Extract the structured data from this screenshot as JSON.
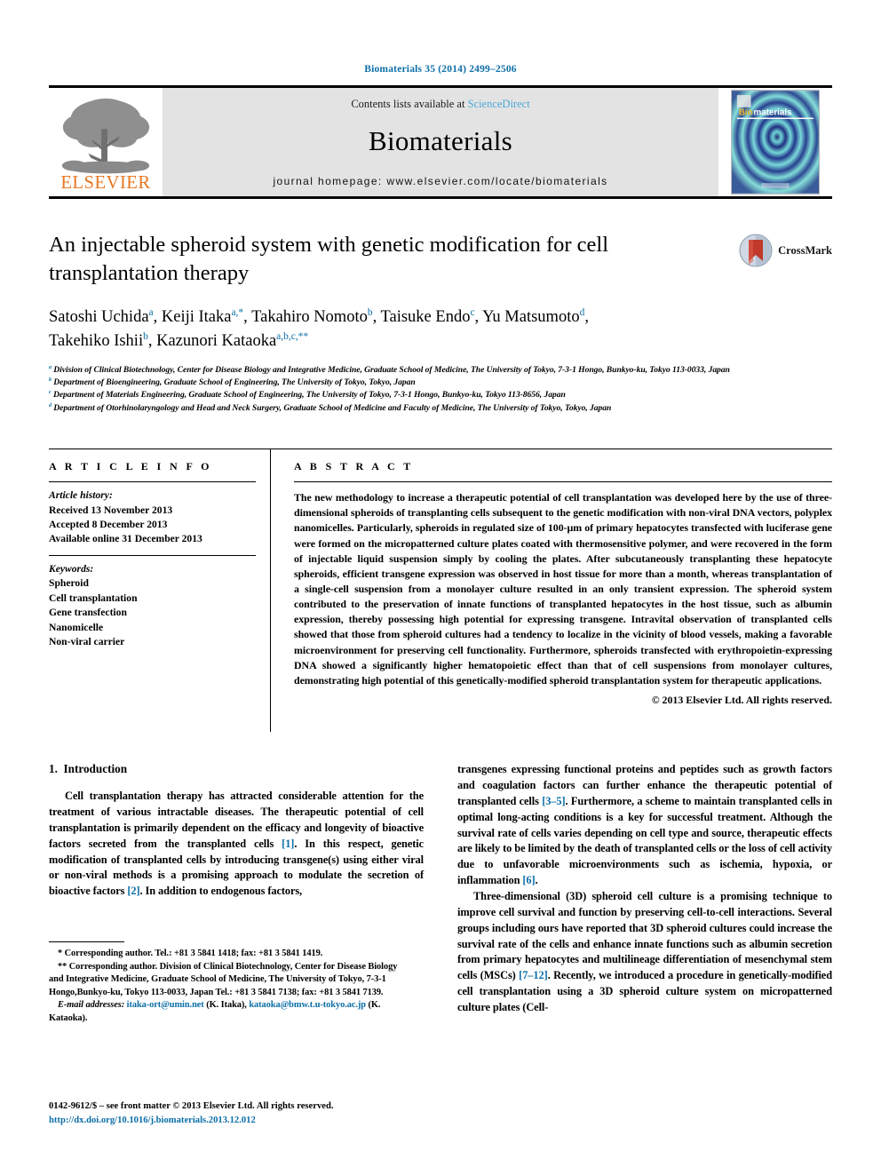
{
  "citation": {
    "journal": "Biomaterials",
    "detail": "35 (2014) 2499–2506",
    "full": "Biomaterials 35 (2014) 2499–2506"
  },
  "masthead": {
    "contents_prefix": "Contents lists available at ",
    "contents_link": "ScienceDirect",
    "journal_name": "Biomaterials",
    "homepage": "journal homepage: www.elsevier.com/locate/biomaterials",
    "publisher_logo_text": "ELSEVIER",
    "cover_title_a": "Bio",
    "cover_title_b": "materials"
  },
  "article": {
    "title": "An injectable spheroid system with genetic modification for cell transplantation therapy",
    "crossmark_label": "CrossMark",
    "authors_line_1": "Satoshi Uchida a, Keiji Itaka a,*, Takahiro Nomoto b, Taisuke Endo c, Yu Matsumoto d,",
    "authors_line_2": "Takehiko Ishii b, Kazunori Kataoka a,b,c,**",
    "authors": [
      {
        "name": "Satoshi Uchida",
        "sup": "a"
      },
      {
        "name": "Keiji Itaka",
        "sup": "a,*"
      },
      {
        "name": "Takahiro Nomoto",
        "sup": "b"
      },
      {
        "name": "Taisuke Endo",
        "sup": "c"
      },
      {
        "name": "Yu Matsumoto",
        "sup": "d"
      },
      {
        "name": "Takehiko Ishii",
        "sup": "b"
      },
      {
        "name": "Kazunori Kataoka",
        "sup": "a,b,c,**"
      }
    ],
    "affiliations": [
      {
        "mark": "a",
        "text": "Division of Clinical Biotechnology, Center for Disease Biology and Integrative Medicine, Graduate School of Medicine, The University of Tokyo, 7-3-1 Hongo, Bunkyo-ku, Tokyo 113-0033, Japan"
      },
      {
        "mark": "b",
        "text": "Department of Bioengineering, Graduate School of Engineering, The University of Tokyo, Tokyo, Japan"
      },
      {
        "mark": "c",
        "text": "Department of Materials Engineering, Graduate School of Engineering, The University of Tokyo, 7-3-1 Hongo, Bunkyo-ku, Tokyo 113-8656, Japan"
      },
      {
        "mark": "d",
        "text": "Department of Otorhinolaryngology and Head and Neck Surgery, Graduate School of Medicine and Faculty of Medicine, The University of Tokyo, Tokyo, Japan"
      }
    ]
  },
  "article_info": {
    "heading": "A R T I C L E   I N F O",
    "history_label": "Article history:",
    "history": [
      "Received 13 November 2013",
      "Accepted 8 December 2013",
      "Available online 31 December 2013"
    ],
    "keywords_label": "Keywords:",
    "keywords": [
      "Spheroid",
      "Cell transplantation",
      "Gene transfection",
      "Nanomicelle",
      "Non-viral carrier"
    ]
  },
  "abstract": {
    "heading": "A B S T R A C T",
    "text": "The new methodology to increase a therapeutic potential of cell transplantation was developed here by the use of three-dimensional spheroids of transplanting cells subsequent to the genetic modification with non-viral DNA vectors, polyplex nanomicelles. Particularly, spheroids in regulated size of 100-µm of primary hepatocytes transfected with luciferase gene were formed on the micropatterned culture plates coated with thermosensitive polymer, and were recovered in the form of injectable liquid suspension simply by cooling the plates. After subcutaneously transplanting these hepatocyte spheroids, efficient transgene expression was observed in host tissue for more than a month, whereas transplantation of a single-cell suspension from a monolayer culture resulted in an only transient expression. The spheroid system contributed to the preservation of innate functions of transplanted hepatocytes in the host tissue, such as albumin expression, thereby possessing high potential for expressing transgene. Intravital observation of transplanted cells showed that those from spheroid cultures had a tendency to localize in the vicinity of blood vessels, making a favorable microenvironment for preserving cell functionality. Furthermore, spheroids transfected with erythropoietin-expressing DNA showed a significantly higher hematopoietic effect than that of cell suspensions from monolayer cultures, demonstrating high potential of this genetically-modified spheroid transplantation system for therapeutic applications.",
    "copyright": "© 2013 Elsevier Ltd. All rights reserved."
  },
  "introduction": {
    "section_number": "1.",
    "section_title": "Introduction",
    "left_paragraph_1_a": "Cell transplantation therapy has attracted considerable attention for the treatment of various intractable diseases. The therapeutic potential of cell transplantation is primarily dependent on the efficacy and longevity of bioactive factors secreted from the transplanted cells ",
    "left_ref_1": "[1]",
    "left_paragraph_1_b": ". In this respect, genetic modification of transplanted cells by introducing transgene(s) using either viral or non-viral methods is a promising approach to modulate the secretion of bioactive factors ",
    "left_ref_2": "[2]",
    "left_paragraph_1_c": ". In addition to endogenous factors,",
    "right_paragraph_1_a": "transgenes expressing functional proteins and peptides such as growth factors and coagulation factors can further enhance the therapeutic potential of transplanted cells ",
    "right_ref_1": "[3–5]",
    "right_paragraph_1_b": ". Furthermore, a scheme to maintain transplanted cells in optimal long-acting conditions is a key for successful treatment. Although the survival rate of cells varies depending on cell type and source, therapeutic effects are likely to be limited by the death of transplanted cells or the loss of cell activity due to unfavorable microenvironments such as ischemia, hypoxia, or inflammation ",
    "right_ref_2": "[6]",
    "right_paragraph_1_c": ".",
    "right_paragraph_2_a": "Three-dimensional (3D) spheroid cell culture is a promising technique to improve cell survival and function by preserving cell-to-cell interactions. Several groups including ours have reported that 3D spheroid cultures could increase the survival rate of the cells and enhance innate functions such as albumin secretion from primary hepatocytes and multilineage differentiation of mesenchymal stem cells (MSCs) ",
    "right_ref_3": "[7–12]",
    "right_paragraph_2_b": ". Recently, we introduced a procedure in genetically-modified cell transplantation using a 3D spheroid culture system on micropatterned culture plates (Cell-"
  },
  "footnotes": {
    "line_1": "* Corresponding author. Tel.: +81 3 5841 1418; fax: +81 3 5841 1419.",
    "line_2": "** Corresponding author. Division of Clinical Biotechnology, Center for Disease Biology and Integrative Medicine, Graduate School of Medicine, The University of Tokyo, 7-3-1 Hongo,Bunkyo-ku, Tokyo 113-0033, Japan Tel.: +81 3 5841 7138; fax: +81 3 5841 7139.",
    "email_label": "E-mail addresses:",
    "email_1": "itaka-ort@umin.net",
    "email_1_owner": "(K. Itaka),",
    "email_2": "kataoka@bmw.t.u-tokyo.ac.jp",
    "email_2_owner": "(K. Kataoka)."
  },
  "issn": {
    "line": "0142-9612/$ – see front matter © 2013 Elsevier Ltd. All rights reserved.",
    "doi": "http://dx.doi.org/10.1016/j.biomaterials.2013.12.012"
  },
  "colors": {
    "link_blue": "#0b6ea8",
    "sciencedirect_blue": "#4aa8d8",
    "elsevier_orange": "#E87722",
    "masthead_grey": "#e3e3e3"
  }
}
